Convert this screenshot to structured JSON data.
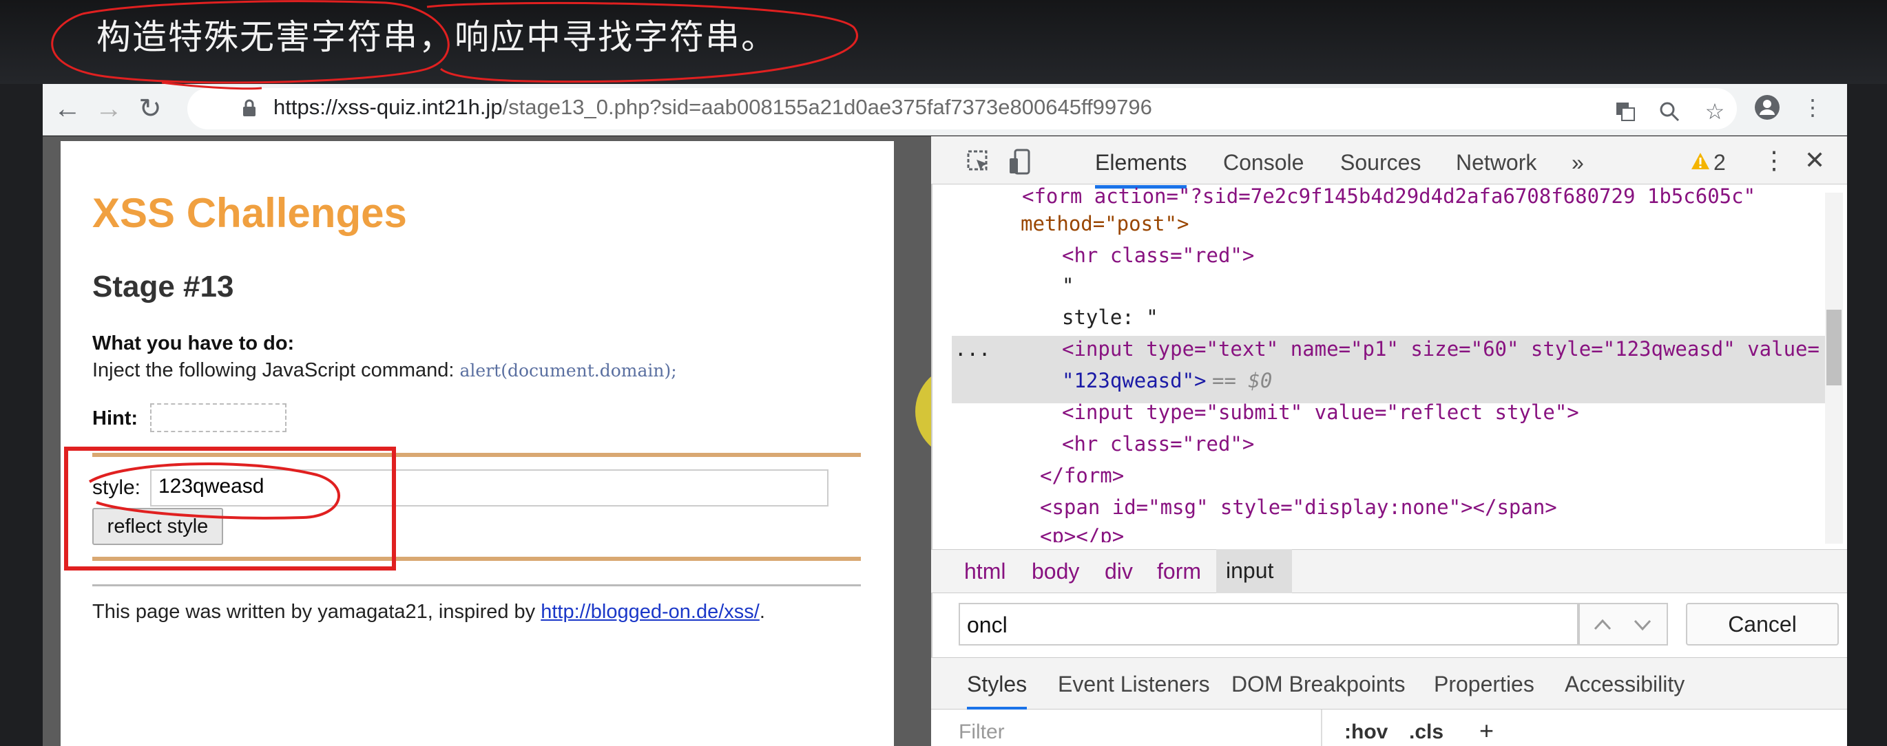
{
  "caption": "构造特殊无害字符串，响应中寻找字符串。",
  "browser": {
    "url_host": "https://xss-quiz.int21h.jp",
    "url_path": "/stage13_0.php?sid=aab008155a21d0ae375faf7373e800645ff99796"
  },
  "page": {
    "title": "XSS Challenges",
    "stage": "Stage #13",
    "todo_label": "What you have to do:",
    "inject_text": "Inject the following JavaScript command: ",
    "inject_code": "alert(document.domain);",
    "hint_label": "Hint:",
    "style_label": "style:",
    "style_value": "123qweasd",
    "reflect_button": "reflect style",
    "footer_text": "This page was written by yamagata21, inspired by ",
    "footer_link": "http://blogged-on.de/xss/",
    "footer_end": "."
  },
  "devtools": {
    "tabs": [
      "Elements",
      "Console",
      "Sources",
      "Network"
    ],
    "more": "»",
    "warnings": "2",
    "dom": {
      "form_open": "<form action=\"?sid=7e2c9f145b4d29d4d2afa6708f680729 1b5c605c\"",
      "l_method": "method=\"post\">",
      "l_hr1": "<hr class=\"red\">",
      "l_quote": "\"",
      "l_style": "style: \"",
      "l_input1a": "<input type=\"text\" name=\"p1\" size=\"60\" style=\"123qweasd\" value=",
      "l_input1b": "\"123qweasd\">",
      "l_eq": "== $0",
      "l_input2": "<input type=\"submit\" value=\"reflect style\">",
      "l_hr2": "<hr class=\"red\">",
      "l_formclose": "</form>",
      "l_span": "<span id=\"msg\" style=\"display:none\"></span>",
      "l_p": "<p></p>",
      "dots": "..."
    },
    "breadcrumbs": [
      "html",
      "body",
      "div",
      "form",
      "input"
    ],
    "search_value": "oncl",
    "cancel": "Cancel",
    "styles_tabs": [
      "Styles",
      "Event Listeners",
      "DOM Breakpoints",
      "Properties",
      "Accessibility"
    ],
    "filter_placeholder": "Filter",
    "hov": ":hov",
    "cls": ".cls",
    "plus": "+"
  }
}
